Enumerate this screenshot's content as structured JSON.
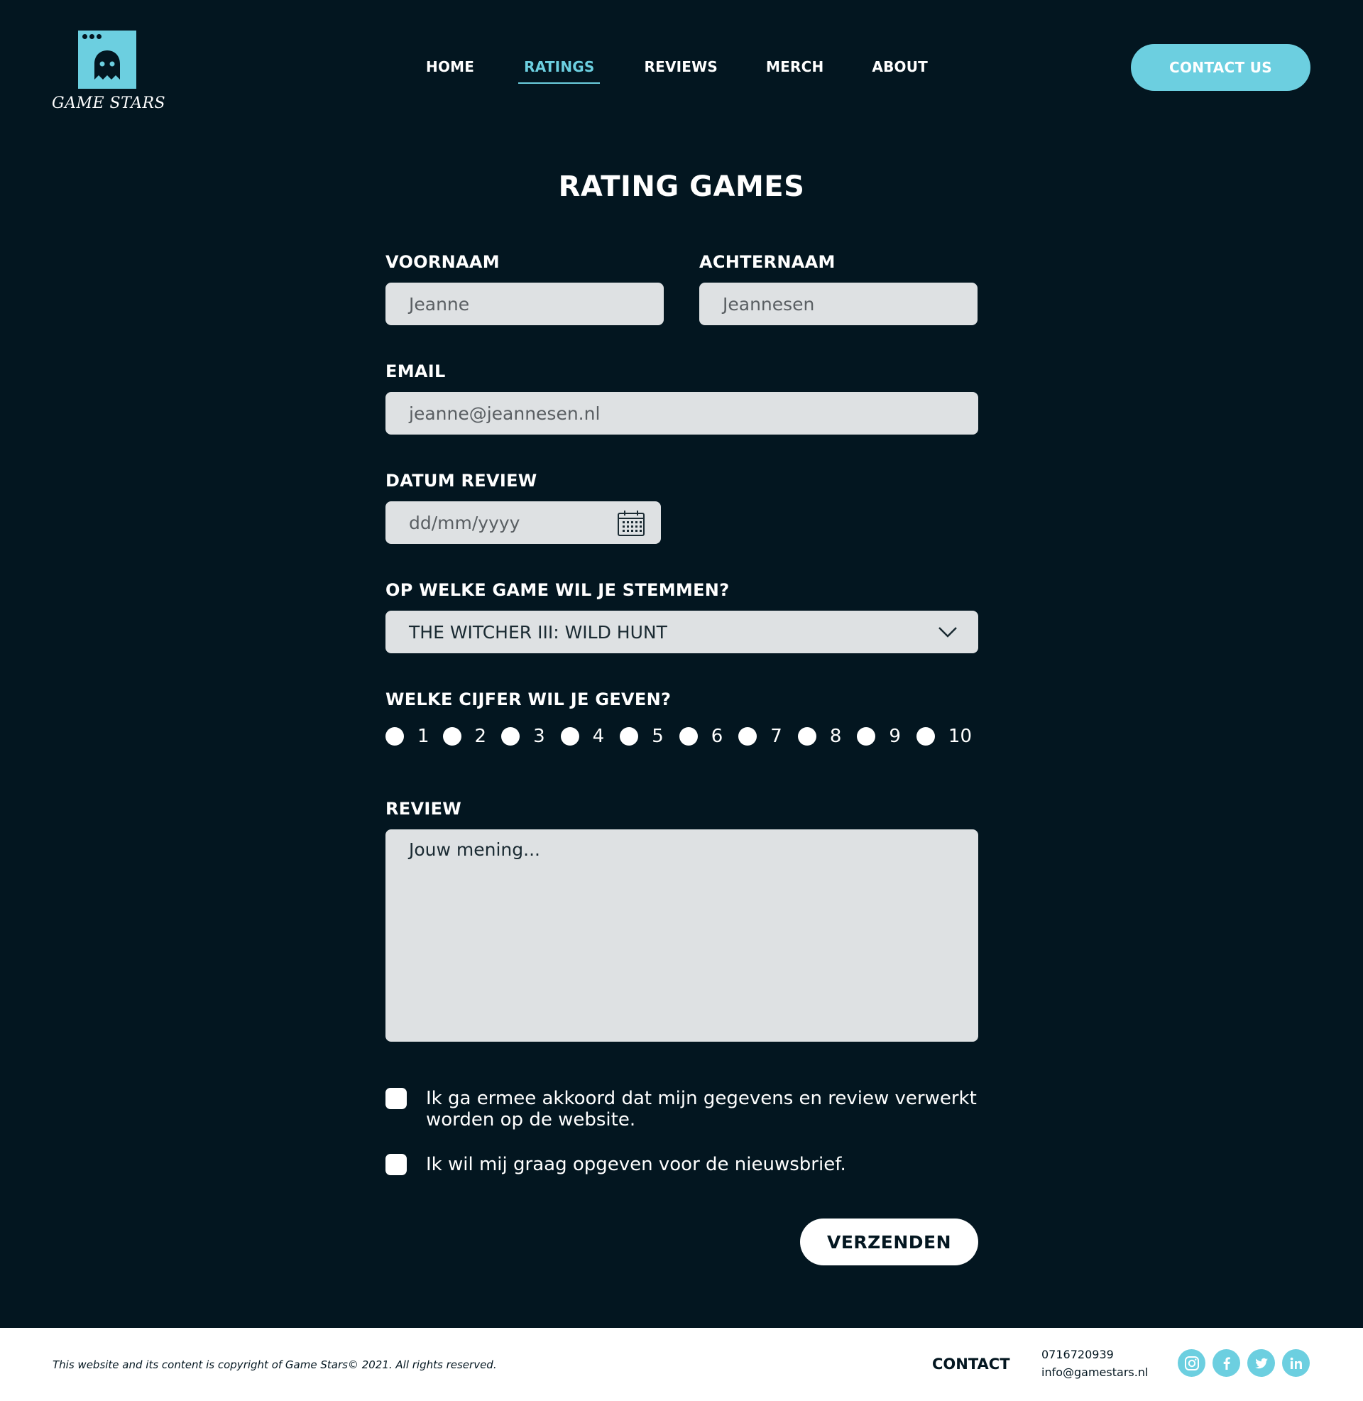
{
  "brand": {
    "name": "GAME STARS",
    "logo_icon": "ghost-icon"
  },
  "nav": {
    "items": [
      {
        "label": "HOME"
      },
      {
        "label": "RATINGS",
        "active": true
      },
      {
        "label": "REVIEWS"
      },
      {
        "label": "MERCH"
      },
      {
        "label": "ABOUT"
      }
    ],
    "contact_button": "CONTACT US"
  },
  "form": {
    "title": "RATING GAMES",
    "firstname": {
      "label": "VOORNAAM",
      "placeholder": "Jeanne"
    },
    "lastname": {
      "label": "ACHTERNAAM",
      "placeholder": "Jeannesen"
    },
    "email": {
      "label": "EMAIL",
      "placeholder": "jeanne@jeannesen.nl"
    },
    "date": {
      "label": "DATUM REVIEW",
      "placeholder": "dd/mm/yyyy",
      "icon": "calendar-icon"
    },
    "game": {
      "label": "OP WELKE GAME WIL JE STEMMEN?",
      "selected": "THE WITCHER III: WILD HUNT",
      "icon": "chevron-down-icon"
    },
    "rating": {
      "label": "WELKE CIJFER WIL JE GEVEN?",
      "options": [
        "1",
        "2",
        "3",
        "4",
        "5",
        "6",
        "7",
        "8",
        "9",
        "10"
      ]
    },
    "review": {
      "label": "REVIEW",
      "placeholder": "Jouw mening..."
    },
    "consent_1": "Ik ga ermee akkoord dat mijn gegevens en review verwerkt worden op de website.",
    "consent_2": "Ik wil mij graag opgeven voor de nieuwsbrief.",
    "submit": "VERZENDEN"
  },
  "footer": {
    "copyright": "This website and its content is copyright of Game Stars© 2021. All rights reserved.",
    "contact_label": "CONTACT",
    "phone": "0716720939",
    "email": "info@gamestars.nl",
    "socials": [
      "instagram-icon",
      "facebook-icon",
      "twitter-icon",
      "linkedin-icon"
    ]
  },
  "colors": {
    "background": "#031620",
    "accent": "#6ccfe0",
    "field": "#dee1e3"
  }
}
